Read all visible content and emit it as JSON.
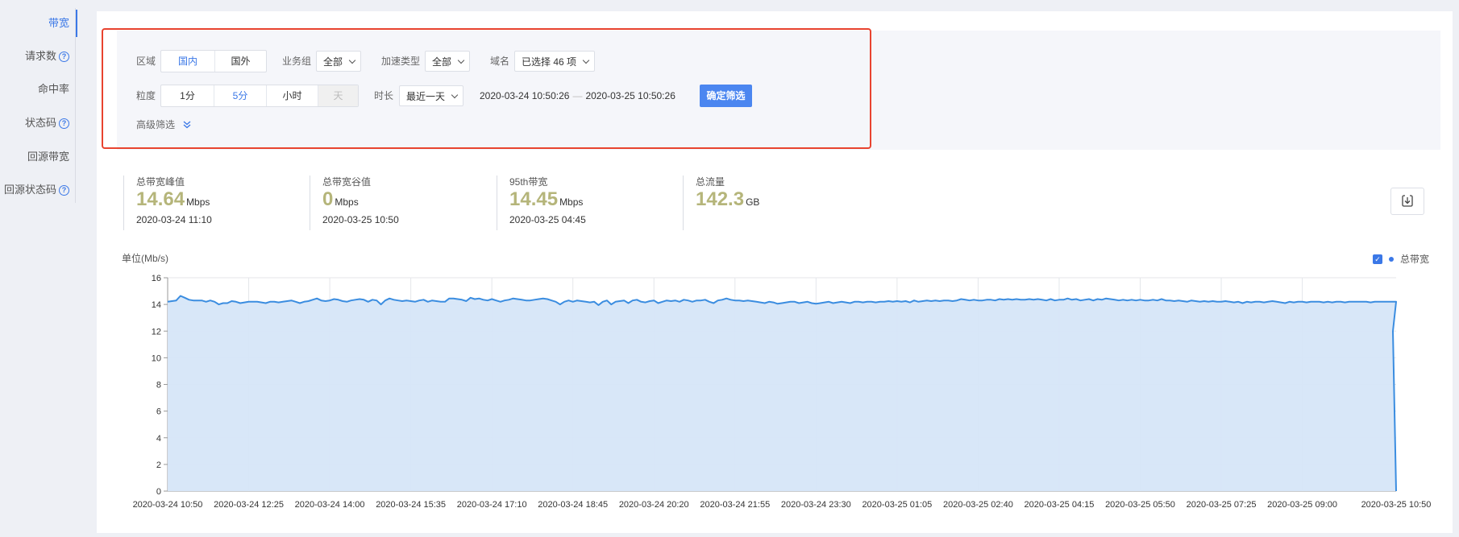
{
  "sidebar": {
    "items": [
      {
        "label": "带宽",
        "help": false,
        "active": true
      },
      {
        "label": "请求数",
        "help": true,
        "active": false
      },
      {
        "label": "命中率",
        "help": false,
        "active": false
      },
      {
        "label": "状态码",
        "help": true,
        "active": false
      },
      {
        "label": "回源带宽",
        "help": false,
        "active": false
      },
      {
        "label": "回源状态码",
        "help": true,
        "active": false
      }
    ],
    "help_glyph": "?"
  },
  "filters": {
    "region_label": "区域",
    "region_options": [
      "国内",
      "国外"
    ],
    "region_selected": "国内",
    "business_group_label": "业务组",
    "business_group_value": "全部",
    "accel_type_label": "加速类型",
    "accel_type_value": "全部",
    "domain_label": "域名",
    "domain_value": "已选择 46 项",
    "granularity_label": "粒度",
    "granularity_options": [
      "1分",
      "5分",
      "小时",
      "天"
    ],
    "granularity_selected": "5分",
    "granularity_disabled": "天",
    "duration_label": "时长",
    "duration_value": "最近一天",
    "range_start": "2020-03-24 10:50:26",
    "range_sep": "—",
    "range_end": "2020-03-25 10:50:26",
    "confirm_label": "确定筛选",
    "advanced_label": "高级筛选"
  },
  "stats": [
    {
      "title": "总带宽峰值",
      "value": "14.64",
      "unit": "Mbps",
      "time": "2020-03-24 11:10"
    },
    {
      "title": "总带宽谷值",
      "value": "0",
      "unit": "Mbps",
      "time": "2020-03-25 10:50"
    },
    {
      "title": "95th带宽",
      "value": "14.45",
      "unit": "Mbps",
      "time": "2020-03-25 04:45"
    },
    {
      "title": "总流量",
      "value": "142.3",
      "unit": "GB",
      "time": ""
    }
  ],
  "toolbar": {
    "download_icon": "download-icon"
  },
  "colors": {
    "accent": "#3b78e7",
    "highlight_border": "#e8432f",
    "stat_value": "#b5b57a",
    "area_fill": "#d6e6f8",
    "line": "#3b8de0"
  },
  "chart_data": {
    "type": "area",
    "ylabel": "单位(Mb/s)",
    "ylim": [
      0,
      16
    ],
    "yticks": [
      0,
      2,
      4,
      6,
      8,
      10,
      12,
      14,
      16
    ],
    "xticks": [
      "2020-03-24 10:50",
      "2020-03-24 12:25",
      "2020-03-24 14:00",
      "2020-03-24 15:35",
      "2020-03-24 17:10",
      "2020-03-24 18:45",
      "2020-03-24 20:20",
      "2020-03-24 21:55",
      "2020-03-24 23:30",
      "2020-03-25 01:05",
      "2020-03-25 02:40",
      "2020-03-25 04:15",
      "2020-03-25 05:50",
      "2020-03-25 07:25",
      "2020-03-25 09:00",
      "2020-03-25 10:50"
    ],
    "grid": true,
    "legend": "top-right",
    "series": [
      {
        "name": "总带宽",
        "interval_minutes": 5,
        "values": [
          14.2,
          14.25,
          14.3,
          14.64,
          14.5,
          14.35,
          14.3,
          14.3,
          14.3,
          14.2,
          14.3,
          14.2,
          14.0,
          14.1,
          14.1,
          14.25,
          14.2,
          14.1,
          14.15,
          14.2,
          14.2,
          14.2,
          14.15,
          14.1,
          14.2,
          14.2,
          14.15,
          14.2,
          14.25,
          14.3,
          14.2,
          14.1,
          14.2,
          14.25,
          14.35,
          14.45,
          14.3,
          14.25,
          14.3,
          14.4,
          14.35,
          14.25,
          14.2,
          14.3,
          14.35,
          14.4,
          14.35,
          14.2,
          14.35,
          14.3,
          14.0,
          14.3,
          14.45,
          14.35,
          14.3,
          14.25,
          14.3,
          14.25,
          14.2,
          14.3,
          14.35,
          14.2,
          14.3,
          14.25,
          14.2,
          14.2,
          14.45,
          14.45,
          14.4,
          14.35,
          14.25,
          14.5,
          14.4,
          14.45,
          14.35,
          14.3,
          14.4,
          14.3,
          14.2,
          14.3,
          14.35,
          14.45,
          14.4,
          14.35,
          14.3,
          14.3,
          14.35,
          14.4,
          14.45,
          14.4,
          14.3,
          14.2,
          14.0,
          14.2,
          14.3,
          14.2,
          14.3,
          14.25,
          14.2,
          14.15,
          14.2,
          13.95,
          14.2,
          14.3,
          14.0,
          14.2,
          14.25,
          14.3,
          14.1,
          14.3,
          14.35,
          14.2,
          14.15,
          14.25,
          14.3,
          14.1,
          14.2,
          14.3,
          14.25,
          14.3,
          14.2,
          14.35,
          14.3,
          14.2,
          14.3,
          14.3,
          14.35,
          14.2,
          14.1,
          14.3,
          14.35,
          14.45,
          14.35,
          14.3,
          14.3,
          14.25,
          14.3,
          14.25,
          14.2,
          14.15,
          14.1,
          14.2,
          14.15,
          14.05,
          14.1,
          14.15,
          14.2,
          14.2,
          14.1,
          14.15,
          14.2,
          14.1,
          14.05,
          14.1,
          14.15,
          14.2,
          14.1,
          14.15,
          14.2,
          14.15,
          14.1,
          14.2,
          14.2,
          14.15,
          14.2,
          14.2,
          14.15,
          14.2,
          14.2,
          14.25,
          14.2,
          14.25,
          14.2,
          14.25,
          14.15,
          14.3,
          14.2,
          14.25,
          14.3,
          14.25,
          14.3,
          14.25,
          14.3,
          14.3,
          14.25,
          14.3,
          14.4,
          14.35,
          14.3,
          14.35,
          14.3,
          14.3,
          14.35,
          14.35,
          14.3,
          14.4,
          14.35,
          14.4,
          14.35,
          14.4,
          14.35,
          14.35,
          14.4,
          14.35,
          14.4,
          14.35,
          14.3,
          14.4,
          14.3,
          14.35,
          14.35,
          14.45,
          14.35,
          14.4,
          14.3,
          14.35,
          14.4,
          14.3,
          14.4,
          14.35,
          14.45,
          14.4,
          14.35,
          14.3,
          14.35,
          14.3,
          14.35,
          14.3,
          14.35,
          14.3,
          14.3,
          14.35,
          14.3,
          14.4,
          14.3,
          14.3,
          14.25,
          14.3,
          14.25,
          14.2,
          14.3,
          14.25,
          14.2,
          14.25,
          14.2,
          14.25,
          14.2,
          14.2,
          14.25,
          14.2,
          14.15,
          14.2,
          14.1,
          14.2,
          14.15,
          14.2,
          14.2,
          14.15,
          14.2,
          14.25,
          14.2,
          14.15,
          14.1,
          14.2,
          14.15,
          14.2,
          14.2,
          14.15,
          14.2,
          14.2,
          14.2,
          14.15,
          14.2,
          14.15,
          14.2,
          14.2,
          14.15,
          14.2,
          14.2,
          14.2,
          14.2,
          14.2,
          14.15,
          14.2,
          14.2,
          14.2,
          14.2,
          14.2,
          14.2,
          12.0,
          0
        ]
      }
    ]
  }
}
